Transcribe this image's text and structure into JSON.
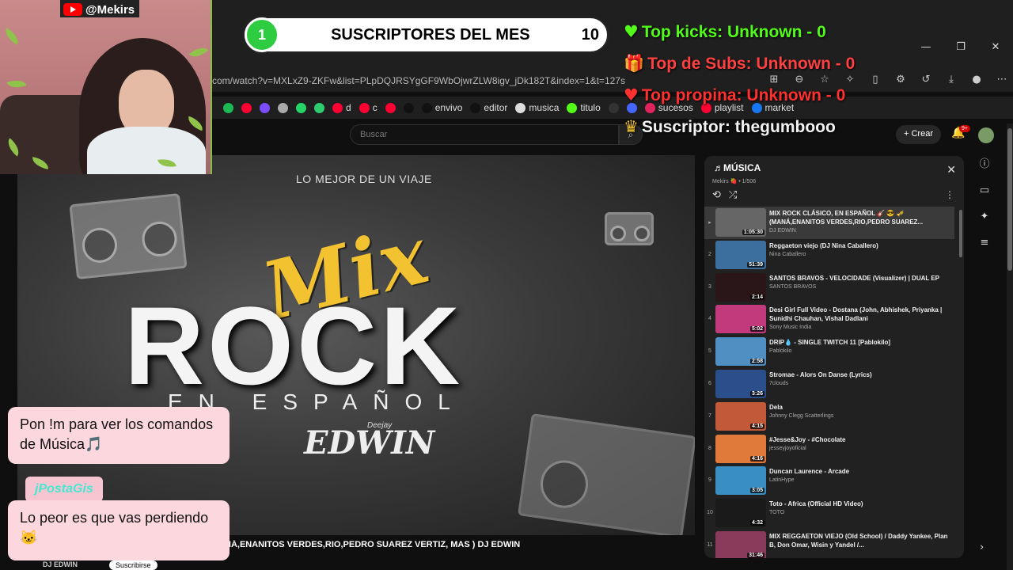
{
  "browser": {
    "url": "com/watch?v=MXLxZ9-ZKFw&list=PLpDQJRSYgGF9WbOjwrZLW8igv_jDk182T&index=1&t=127s",
    "window_buttons": [
      "—",
      "❐",
      "✕"
    ],
    "bookmarks": [
      {
        "label": "",
        "color": "#1db954"
      },
      {
        "label": "",
        "color": "#ff0033"
      },
      {
        "label": "",
        "color": "#7b4dff"
      },
      {
        "label": "",
        "color": "#aaaaaa"
      },
      {
        "label": "",
        "color": "#25d366"
      },
      {
        "label": "",
        "color": "#2ecc71"
      },
      {
        "label": "d",
        "color": "#ff0033"
      },
      {
        "label": "c",
        "color": "#ff0033"
      },
      {
        "label": "",
        "color": "#ff0033"
      },
      {
        "label": "",
        "color": "#111111"
      },
      {
        "label": "envivo",
        "color": "#111111"
      },
      {
        "label": "editor",
        "color": "#111111"
      },
      {
        "label": "musica",
        "color": "#dddddd"
      },
      {
        "label": "titulo",
        "color": "#53fc18"
      },
      {
        "label": "",
        "color": "#333333"
      },
      {
        "label": "",
        "color": "#4466ff"
      },
      {
        "label": "sucesos",
        "color": "#e0245e"
      },
      {
        "label": "playlist",
        "color": "#ff0033"
      },
      {
        "label": "market",
        "color": "#1877f2"
      }
    ]
  },
  "youtube": {
    "search_placeholder": "Buscar",
    "create_label": "+ Crear",
    "notif_count": "9+"
  },
  "video": {
    "top_caption": "LO MEJOR DE UN VIAJE",
    "mix": "Mix",
    "rock": "ROCK",
    "espanol": "EN ESPAÑOL",
    "deejay": "Deejay",
    "edwin": "EDWIN",
    "title_fragment": "NÁ,ENANITOS VERDES,RIO,PEDRO SUAREZ VERTIZ, MAS ) DJ EDWIN",
    "channel": "DJ EDWIN",
    "subscribe": "Suscribirse"
  },
  "playlist": {
    "title": "♬MÚSICA",
    "subtitle": "Mekirs 🍓 • 1/506",
    "items": [
      {
        "idx": "▸",
        "title": "MIX ROCK CLÁSICO, EN ESPAÑOL 🎸 😎 🎺 (MANÁ,ENANITOS VERDES,RIO,PEDRO SUAREZ...",
        "channel": "DJ EDWIN",
        "duration": "1:05:30",
        "color": "#666666",
        "active": true
      },
      {
        "idx": "2",
        "title": "Reggaeton viejo (DJ Nina Caballero)",
        "channel": "Nina Caballero",
        "duration": "51:39",
        "color": "#3d6f9e"
      },
      {
        "idx": "3",
        "title": "SANTOS BRAVOS - VELOCIDADE (Visualizer) | DUAL EP",
        "channel": "SANTOS BRAVOS",
        "duration": "2:14",
        "color": "#2a1518"
      },
      {
        "idx": "4",
        "title": "Desi Girl Full Video - Dostana (John, Abhishek, Priyanka | Sunidhi Chauhan, Vishal Dadlani",
        "channel": "Sony Music India",
        "duration": "5:02",
        "color": "#c2397c"
      },
      {
        "idx": "5",
        "title": "DRIP💧 - SINGLE TWITCH 11 [Pablokilo]",
        "channel": "Pablokilo",
        "duration": "2:58",
        "color": "#4f8fc2"
      },
      {
        "idx": "6",
        "title": "Stromae - Alors On Danse (Lyrics)",
        "channel": "7clouds",
        "duration": "3:26",
        "color": "#2a4f8a"
      },
      {
        "idx": "7",
        "title": "Dela",
        "channel": "Johnny Clegg Scatterlings",
        "duration": "4:15",
        "color": "#c25a3a"
      },
      {
        "idx": "8",
        "title": "#Jesse&Joy - #Chocolate",
        "channel": "jesseyjoyoficial",
        "duration": "4:16",
        "color": "#e07a3a"
      },
      {
        "idx": "9",
        "title": "Duncan Laurence - Arcade",
        "channel": "LatinHype",
        "duration": "3:05",
        "color": "#3a8fc2"
      },
      {
        "idx": "10",
        "title": "Toto - Africa (Official HD Video)",
        "channel": "TOTO",
        "duration": "4:32",
        "color": "#1a1a1a"
      },
      {
        "idx": "11",
        "title": "MIX REGGAETON VIEJO (Old School) / Daddy Yankee, Plan B, Don Omar, Wisin y Yandel /...",
        "channel": "",
        "duration": "31:46",
        "color": "#8a3a5a"
      }
    ]
  },
  "overlay": {
    "channel_handle": "@Mekirs",
    "subs_count": "1",
    "subs_label": "SUSCRIPTORES DEL MES",
    "subs_goal": "10",
    "top_kicks": "Top kicks: Unknown - 0",
    "top_subs": "Top de Subs: Unknown - 0",
    "top_propina": "Top propina: Unknown - 0",
    "suscriptor": "Suscriptor: thegumbooo",
    "chat": [
      {
        "user": "",
        "text": "Pon !m para ver los comandos de Música🎵"
      },
      {
        "user": "jPostaGis",
        "text": "Lo peor es que vas perdiendo 🐱"
      }
    ]
  }
}
